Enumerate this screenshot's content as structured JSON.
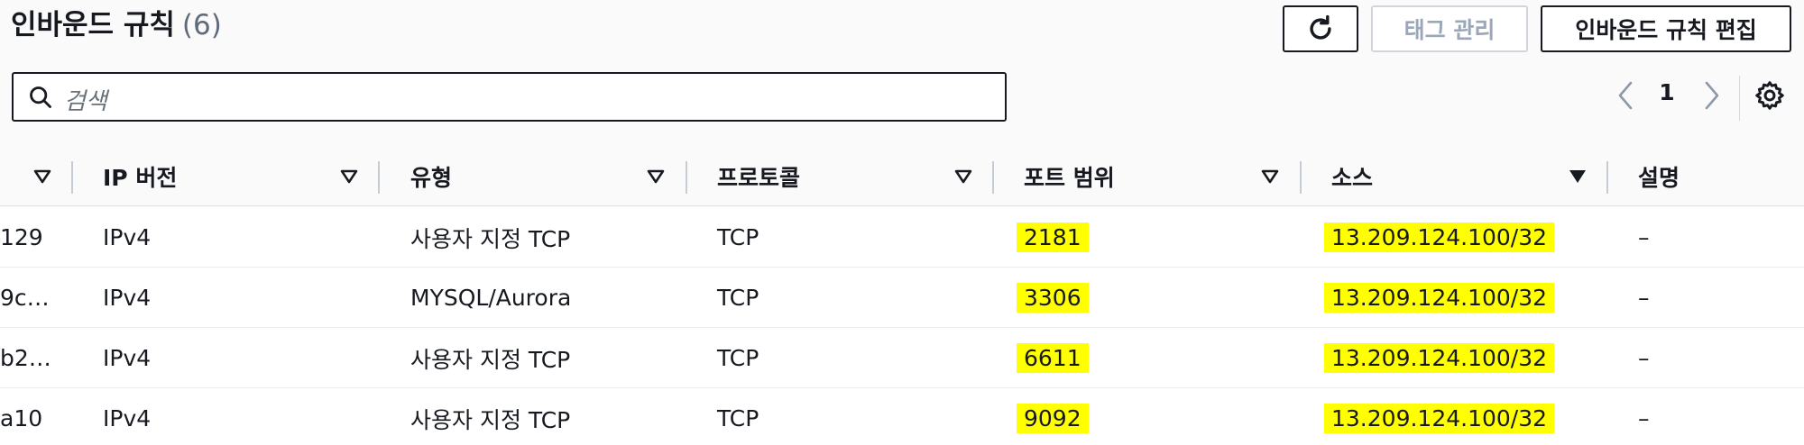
{
  "header": {
    "title": "인바운드 규칙",
    "count": "(6)"
  },
  "toolbar": {
    "refresh_icon": "refresh-icon",
    "manage_tags_label": "태그 관리",
    "edit_rules_label": "인바운드 규칙 편집"
  },
  "search": {
    "placeholder": "검색",
    "icon": "search-icon"
  },
  "pagination": {
    "current_page": "1",
    "prev_icon": "chevron-left-icon",
    "next_icon": "chevron-right-icon",
    "settings_icon": "gear-icon"
  },
  "table": {
    "columns": [
      {
        "label": ""
      },
      {
        "label": "IP 버전"
      },
      {
        "label": "유형"
      },
      {
        "label": "프로토콜"
      },
      {
        "label": "포트 범위"
      },
      {
        "label": "소스"
      },
      {
        "label": "설명"
      }
    ],
    "rows": [
      {
        "id": "129",
        "ip_version": "IPv4",
        "type": "사용자 지정 TCP",
        "protocol": "TCP",
        "port_range": "2181",
        "source": "13.209.124.100/32",
        "description": "–"
      },
      {
        "id": "9c…",
        "ip_version": "IPv4",
        "type": "MYSQL/Aurora",
        "protocol": "TCP",
        "port_range": "3306",
        "source": "13.209.124.100/32",
        "description": "–"
      },
      {
        "id": "b2…",
        "ip_version": "IPv4",
        "type": "사용자 지정 TCP",
        "protocol": "TCP",
        "port_range": "6611",
        "source": "13.209.124.100/32",
        "description": "–"
      },
      {
        "id": "a10",
        "ip_version": "IPv4",
        "type": "사용자 지정 TCP",
        "protocol": "TCP",
        "port_range": "9092",
        "source": "13.209.124.100/32",
        "description": "–"
      }
    ]
  },
  "colors": {
    "highlight": "#ffff00",
    "text": "#16191f",
    "muted": "#5f6b7a"
  }
}
